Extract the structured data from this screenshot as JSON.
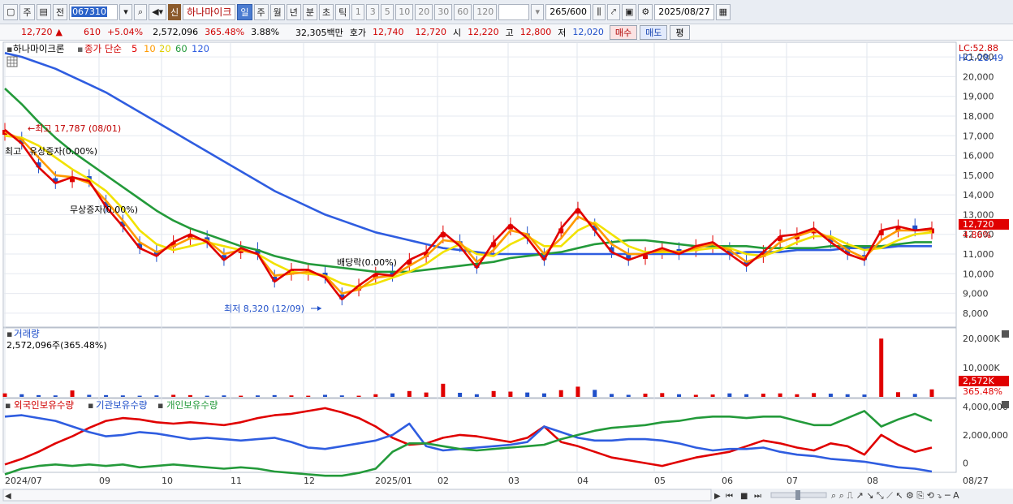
{
  "toolbar": {
    "period_main": "주",
    "prev_label": "전",
    "stock_code": "067310",
    "credit_badge": "신",
    "stock_name": "하나마이크",
    "periods": [
      "일",
      "주",
      "월",
      "년",
      "분",
      "초",
      "틱"
    ],
    "active_period": "일",
    "intervals": [
      "1",
      "3",
      "5",
      "10",
      "20",
      "30",
      "60",
      "120"
    ],
    "count": "265",
    "count_max": "/600",
    "date": "2025/08/27"
  },
  "quote": {
    "price": "12,720",
    "change_arrow": "▲",
    "change": "610",
    "change_pct": "+5.04%",
    "volume": "2,572,096",
    "volume_ratio": "365.48%",
    "turnover": "3.88%",
    "amount": "32,305백만",
    "ask_label": "호가",
    "ask1": "12,740",
    "ask2": "12,720",
    "open_label": "시",
    "open": "12,220",
    "high_label": "고",
    "high": "12,800",
    "low_label": "저",
    "low": "12,020",
    "buy_label": "매수",
    "sell_label": "매도",
    "flat_label": "평"
  },
  "legend": {
    "stock": "하나마이크론",
    "ma_label": "종가 단순",
    "ma_periods": [
      "5",
      "10",
      "20",
      "60",
      "120"
    ],
    "lc": "LC:52.88",
    "hc": "HC:-28.49"
  },
  "colors": {
    "ma5": "#e00000",
    "ma10": "#ff9a00",
    "ma20": "#f2e200",
    "ma60": "#239a3a",
    "ma120": "#2f5de0",
    "up": "#e00000",
    "down": "#1f4fc9"
  },
  "annotations": {
    "high": "←최고 17,787 (08/01)",
    "low": "최저 8,320 (12/09)",
    "event1": "유상증자(0.00%)",
    "event1_prefix": "최고",
    "event2": "무상증자(0.00%)",
    "event3": "배당락(0.00%)"
  },
  "volume_panel": {
    "title": "거래량",
    "value": "2,572,096주(365.48%)",
    "current": "2,572K",
    "ratio": "365.48%"
  },
  "holdings_panel": {
    "series": [
      "외국인보유수량",
      "기관보유수량",
      "개인보유수량"
    ]
  },
  "current_price_tag": "12,720",
  "current_pct_tag": "4.86%",
  "chart_data": [
    {
      "type": "line",
      "title": "하나마이크론",
      "subtitle": "종가 단순 5 10 20 60 120",
      "xlabel": "",
      "ylabel": "",
      "x_ticks": [
        "2024/07",
        "09",
        "10",
        "11",
        "12",
        "2025/01",
        "02",
        "03",
        "04",
        "05",
        "06",
        "07",
        "08",
        "08/27"
      ],
      "y_ticks": [
        8000,
        9000,
        10000,
        11000,
        12000,
        13000,
        14000,
        15000,
        16000,
        17000,
        18000,
        19000,
        20000,
        21000
      ],
      "ylim": [
        7500,
        21500
      ],
      "grid": true,
      "series": [
        {
          "name": "5",
          "values": [
            17300,
            16600,
            15400,
            14600,
            14900,
            14700,
            13400,
            12400,
            11300,
            10900,
            11600,
            12000,
            11600,
            10700,
            11300,
            11000,
            9600,
            10200,
            10200,
            9800,
            8700,
            9400,
            10000,
            9900,
            10700,
            11100,
            12100,
            11400,
            10300,
            11600,
            12500,
            11800,
            10700,
            12300,
            13300,
            12200,
            11100,
            10700,
            11000,
            11300,
            11000,
            11400,
            11600,
            11000,
            10400,
            11100,
            11900,
            12000,
            12300,
            11600,
            11000,
            10700,
            12200,
            12400,
            12200,
            12300
          ]
        },
        {
          "name": "10",
          "values": [
            17200,
            16800,
            15900,
            15000,
            14900,
            14600,
            13700,
            12700,
            11600,
            11100,
            11400,
            11800,
            11700,
            11000,
            11200,
            11000,
            9900,
            10000,
            10100,
            9900,
            9000,
            9200,
            9800,
            9900,
            10400,
            10900,
            11700,
            11600,
            10600,
            11200,
            12200,
            12000,
            11000,
            11800,
            12900,
            12500,
            11500,
            11000,
            11000,
            11200,
            11100,
            11300,
            11500,
            11200,
            10600,
            10900,
            11600,
            11900,
            12200,
            11800,
            11200,
            10800,
            11700,
            12200,
            12200,
            12200
          ]
        },
        {
          "name": "20",
          "values": [
            17000,
            16900,
            16500,
            15900,
            15300,
            14800,
            14200,
            13300,
            12200,
            11500,
            11200,
            11400,
            11600,
            11400,
            11200,
            11000,
            10500,
            10100,
            10000,
            9900,
            9500,
            9300,
            9500,
            9800,
            10100,
            10500,
            11100,
            11500,
            11000,
            10900,
            11500,
            11900,
            11400,
            11400,
            12200,
            12600,
            12000,
            11400,
            11100,
            11100,
            11100,
            11200,
            11300,
            11300,
            11000,
            10900,
            11200,
            11600,
            11900,
            11900,
            11500,
            11200,
            11300,
            11700,
            12000,
            12100
          ]
        },
        {
          "name": "60",
          "values": [
            19400,
            18600,
            17700,
            16900,
            16200,
            15600,
            15000,
            14400,
            13800,
            13200,
            12700,
            12300,
            12000,
            11700,
            11400,
            11200,
            10900,
            10700,
            10500,
            10400,
            10300,
            10200,
            10100,
            10100,
            10100,
            10200,
            10300,
            10400,
            10500,
            10600,
            10800,
            10900,
            11000,
            11100,
            11300,
            11500,
            11600,
            11700,
            11700,
            11600,
            11500,
            11400,
            11400,
            11400,
            11400,
            11300,
            11300,
            11300,
            11300,
            11400,
            11400,
            11400,
            11400,
            11500,
            11600,
            11600
          ]
        },
        {
          "name": "120",
          "values": [
            21200,
            21000,
            20700,
            20400,
            20000,
            19600,
            19200,
            18700,
            18200,
            17700,
            17200,
            16700,
            16200,
            15700,
            15200,
            14700,
            14200,
            13800,
            13400,
            13000,
            12700,
            12400,
            12100,
            11900,
            11700,
            11500,
            11300,
            11200,
            11100,
            11000,
            11000,
            11000,
            11000,
            11000,
            11000,
            11000,
            11000,
            11000,
            11000,
            11000,
            11000,
            11000,
            11000,
            11000,
            11100,
            11100,
            11100,
            11200,
            11200,
            11200,
            11300,
            11300,
            11300,
            11400,
            11400,
            11400
          ]
        }
      ]
    },
    {
      "type": "bar",
      "title": "거래량",
      "y_ticks": [
        "10,000K",
        "20,000K"
      ],
      "ylim": [
        0,
        22000
      ],
      "unit": "K",
      "values": [
        1200,
        900,
        600,
        500,
        2200,
        700,
        600,
        500,
        400,
        500,
        700,
        600,
        400,
        500,
        400,
        500,
        600,
        500,
        400,
        700,
        500,
        400,
        900,
        1200,
        2000,
        1500,
        4500,
        1400,
        900,
        2000,
        1800,
        1500,
        1200,
        2300,
        3500,
        2400,
        1000,
        700,
        1100,
        1300,
        900,
        700,
        800,
        1200,
        900,
        1100,
        1200,
        900,
        1300,
        1100,
        900,
        800,
        20000,
        1600,
        1000,
        2572
      ]
    },
    {
      "type": "line",
      "title": "",
      "y_ticks": [
        0,
        2000000,
        4000000
      ],
      "ylim": [
        -600000,
        4300000
      ],
      "series": [
        {
          "name": "외국인보유수량",
          "values": [
            -100000,
            300000,
            800000,
            1400000,
            1900000,
            2500000,
            3000000,
            3200000,
            3100000,
            2900000,
            2800000,
            2900000,
            2800000,
            2700000,
            2900000,
            3200000,
            3400000,
            3500000,
            3700000,
            3900000,
            3600000,
            3200000,
            2600000,
            1800000,
            1300000,
            1400000,
            1800000,
            2000000,
            1900000,
            1700000,
            1500000,
            1800000,
            2600000,
            1500000,
            1200000,
            800000,
            400000,
            200000,
            0,
            -200000,
            100000,
            400000,
            600000,
            800000,
            1200000,
            1600000,
            1400000,
            1100000,
            900000,
            1400000,
            1200000,
            600000,
            2000000,
            1300000,
            800000,
            1100000
          ]
        },
        {
          "name": "기관보유수량",
          "values": [
            3300000,
            3400000,
            3200000,
            3000000,
            2600000,
            2200000,
            1900000,
            2000000,
            2200000,
            2100000,
            1900000,
            1700000,
            1800000,
            1700000,
            1600000,
            1700000,
            1800000,
            1500000,
            1100000,
            1000000,
            1200000,
            1400000,
            1600000,
            2000000,
            2800000,
            1200000,
            900000,
            1000000,
            1100000,
            1200000,
            1300000,
            1500000,
            2600000,
            2200000,
            1800000,
            1600000,
            1600000,
            1700000,
            1700000,
            1600000,
            1400000,
            1100000,
            900000,
            1000000,
            1000000,
            1100000,
            800000,
            600000,
            500000,
            300000,
            200000,
            100000,
            -100000,
            -300000,
            -400000,
            -600000
          ]
        },
        {
          "name": "개인보유수량",
          "values": [
            -800000,
            -400000,
            -200000,
            -100000,
            -200000,
            -100000,
            -200000,
            -100000,
            -300000,
            -200000,
            -100000,
            -200000,
            -300000,
            -400000,
            -300000,
            -400000,
            -600000,
            -700000,
            -800000,
            -900000,
            -900000,
            -700000,
            -400000,
            800000,
            1400000,
            1400000,
            1200000,
            1000000,
            900000,
            1000000,
            1100000,
            1200000,
            1300000,
            1700000,
            2000000,
            2300000,
            2500000,
            2600000,
            2700000,
            2900000,
            3000000,
            3200000,
            3300000,
            3300000,
            3200000,
            3300000,
            3300000,
            3000000,
            2700000,
            2700000,
            3200000,
            3700000,
            2600000,
            3100000,
            3500000,
            3000000
          ]
        }
      ]
    }
  ]
}
